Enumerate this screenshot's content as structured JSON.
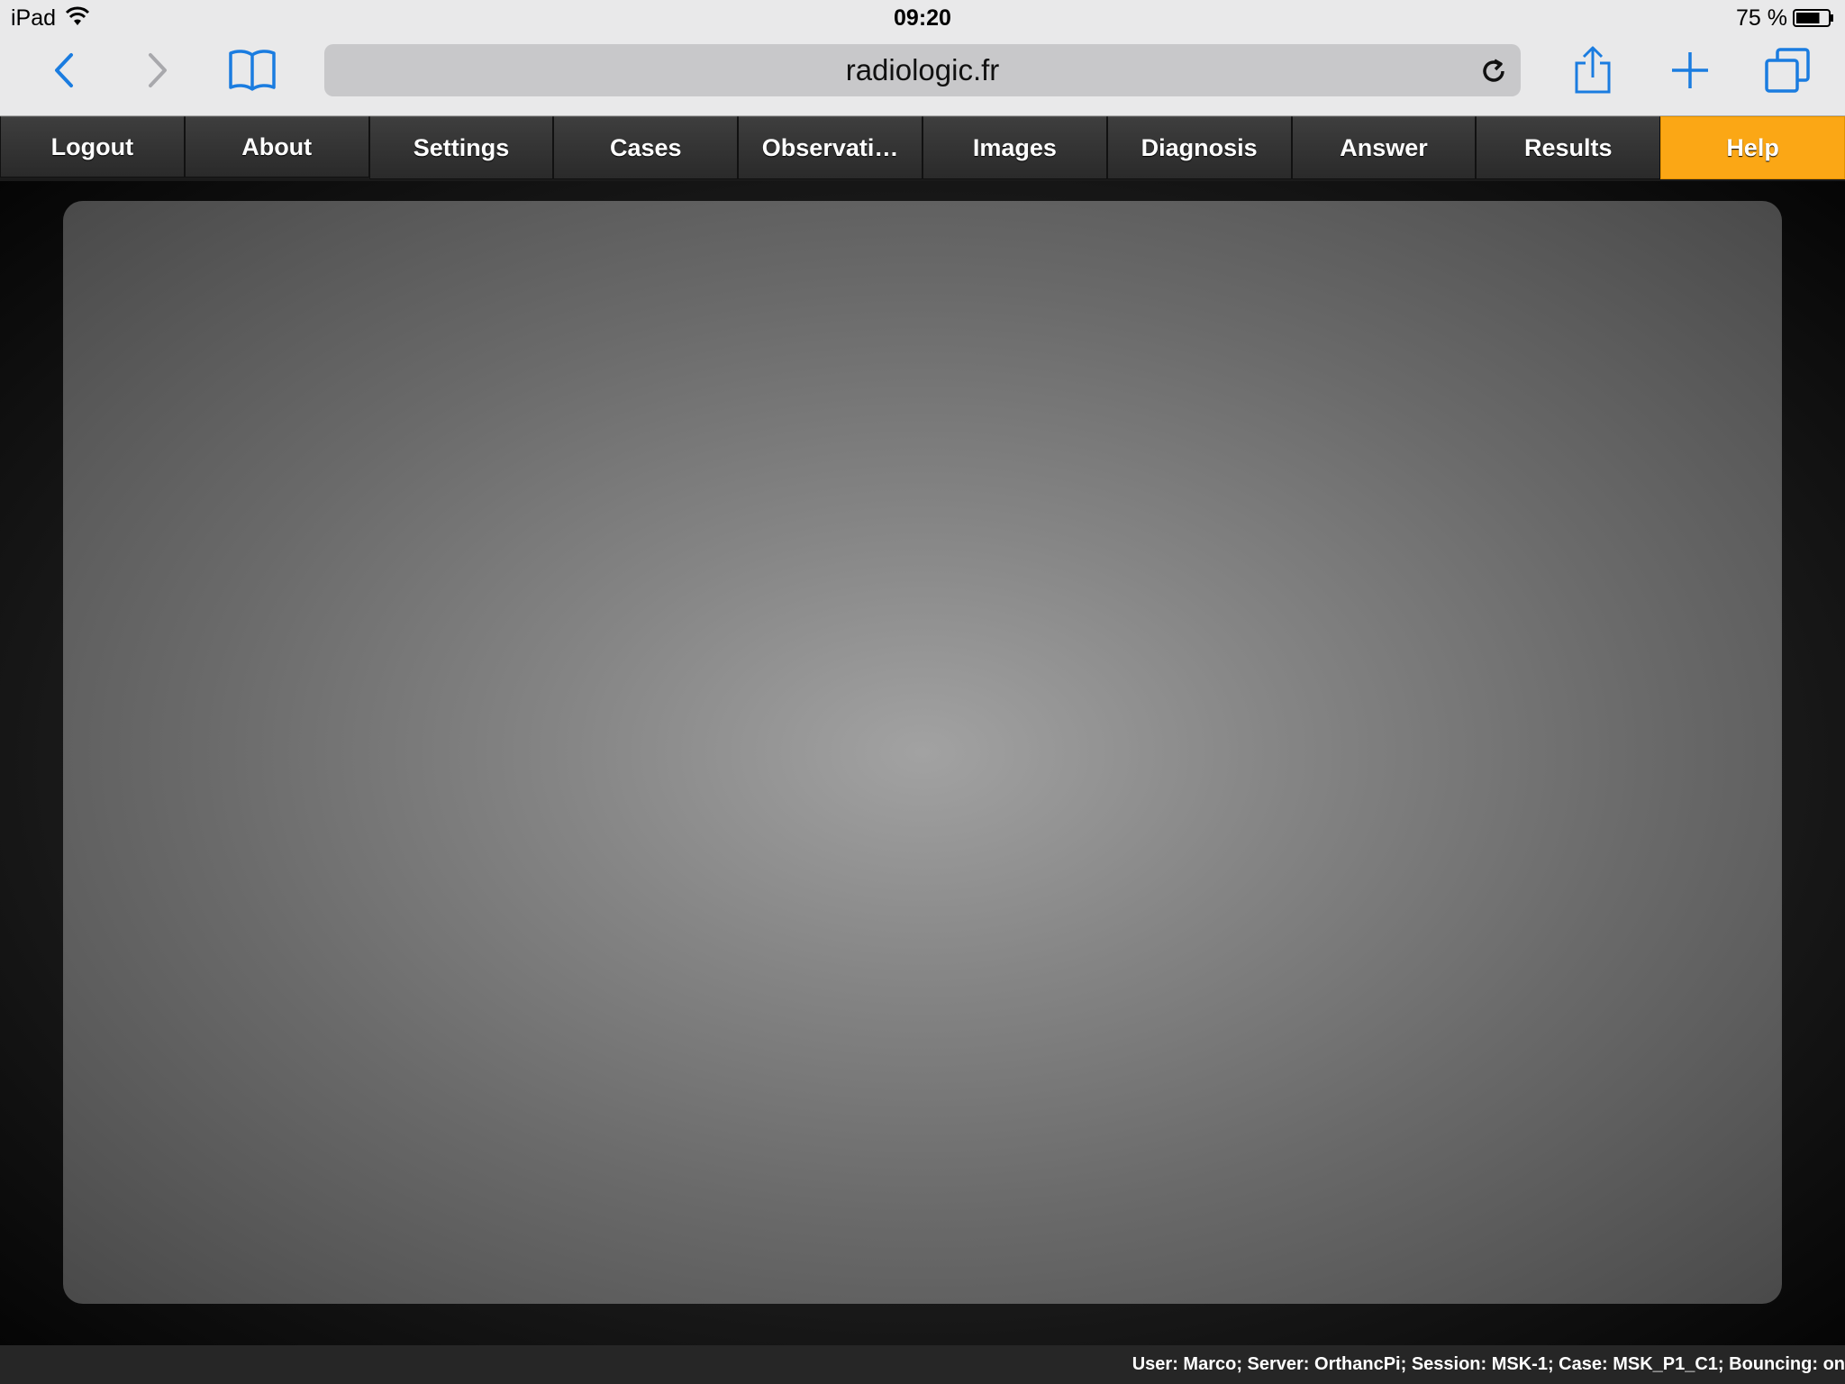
{
  "status_bar": {
    "device": "iPad",
    "time": "09:20",
    "battery_text": "75 %",
    "battery_level": 0.75
  },
  "browser": {
    "url": "radiologic.fr",
    "accent_color": "#1a7ce0"
  },
  "nav": {
    "tabs": [
      {
        "id": "logout",
        "label": "Logout"
      },
      {
        "id": "about",
        "label": "About"
      },
      {
        "id": "settings",
        "label": "Settings"
      },
      {
        "id": "cases",
        "label": "Cases"
      },
      {
        "id": "observations",
        "label": "Observati…"
      },
      {
        "id": "images",
        "label": "Images"
      },
      {
        "id": "diagnosis",
        "label": "Diagnosis"
      },
      {
        "id": "answer",
        "label": "Answer"
      },
      {
        "id": "results",
        "label": "Results"
      },
      {
        "id": "help",
        "label": "Help"
      }
    ],
    "active_tab": "help",
    "active_color": "#fba715"
  },
  "footer": {
    "text": "User: Marco; Server: OrthancPi; Session: MSK-1; Case: MSK_P1_C1; Bouncing: on"
  }
}
